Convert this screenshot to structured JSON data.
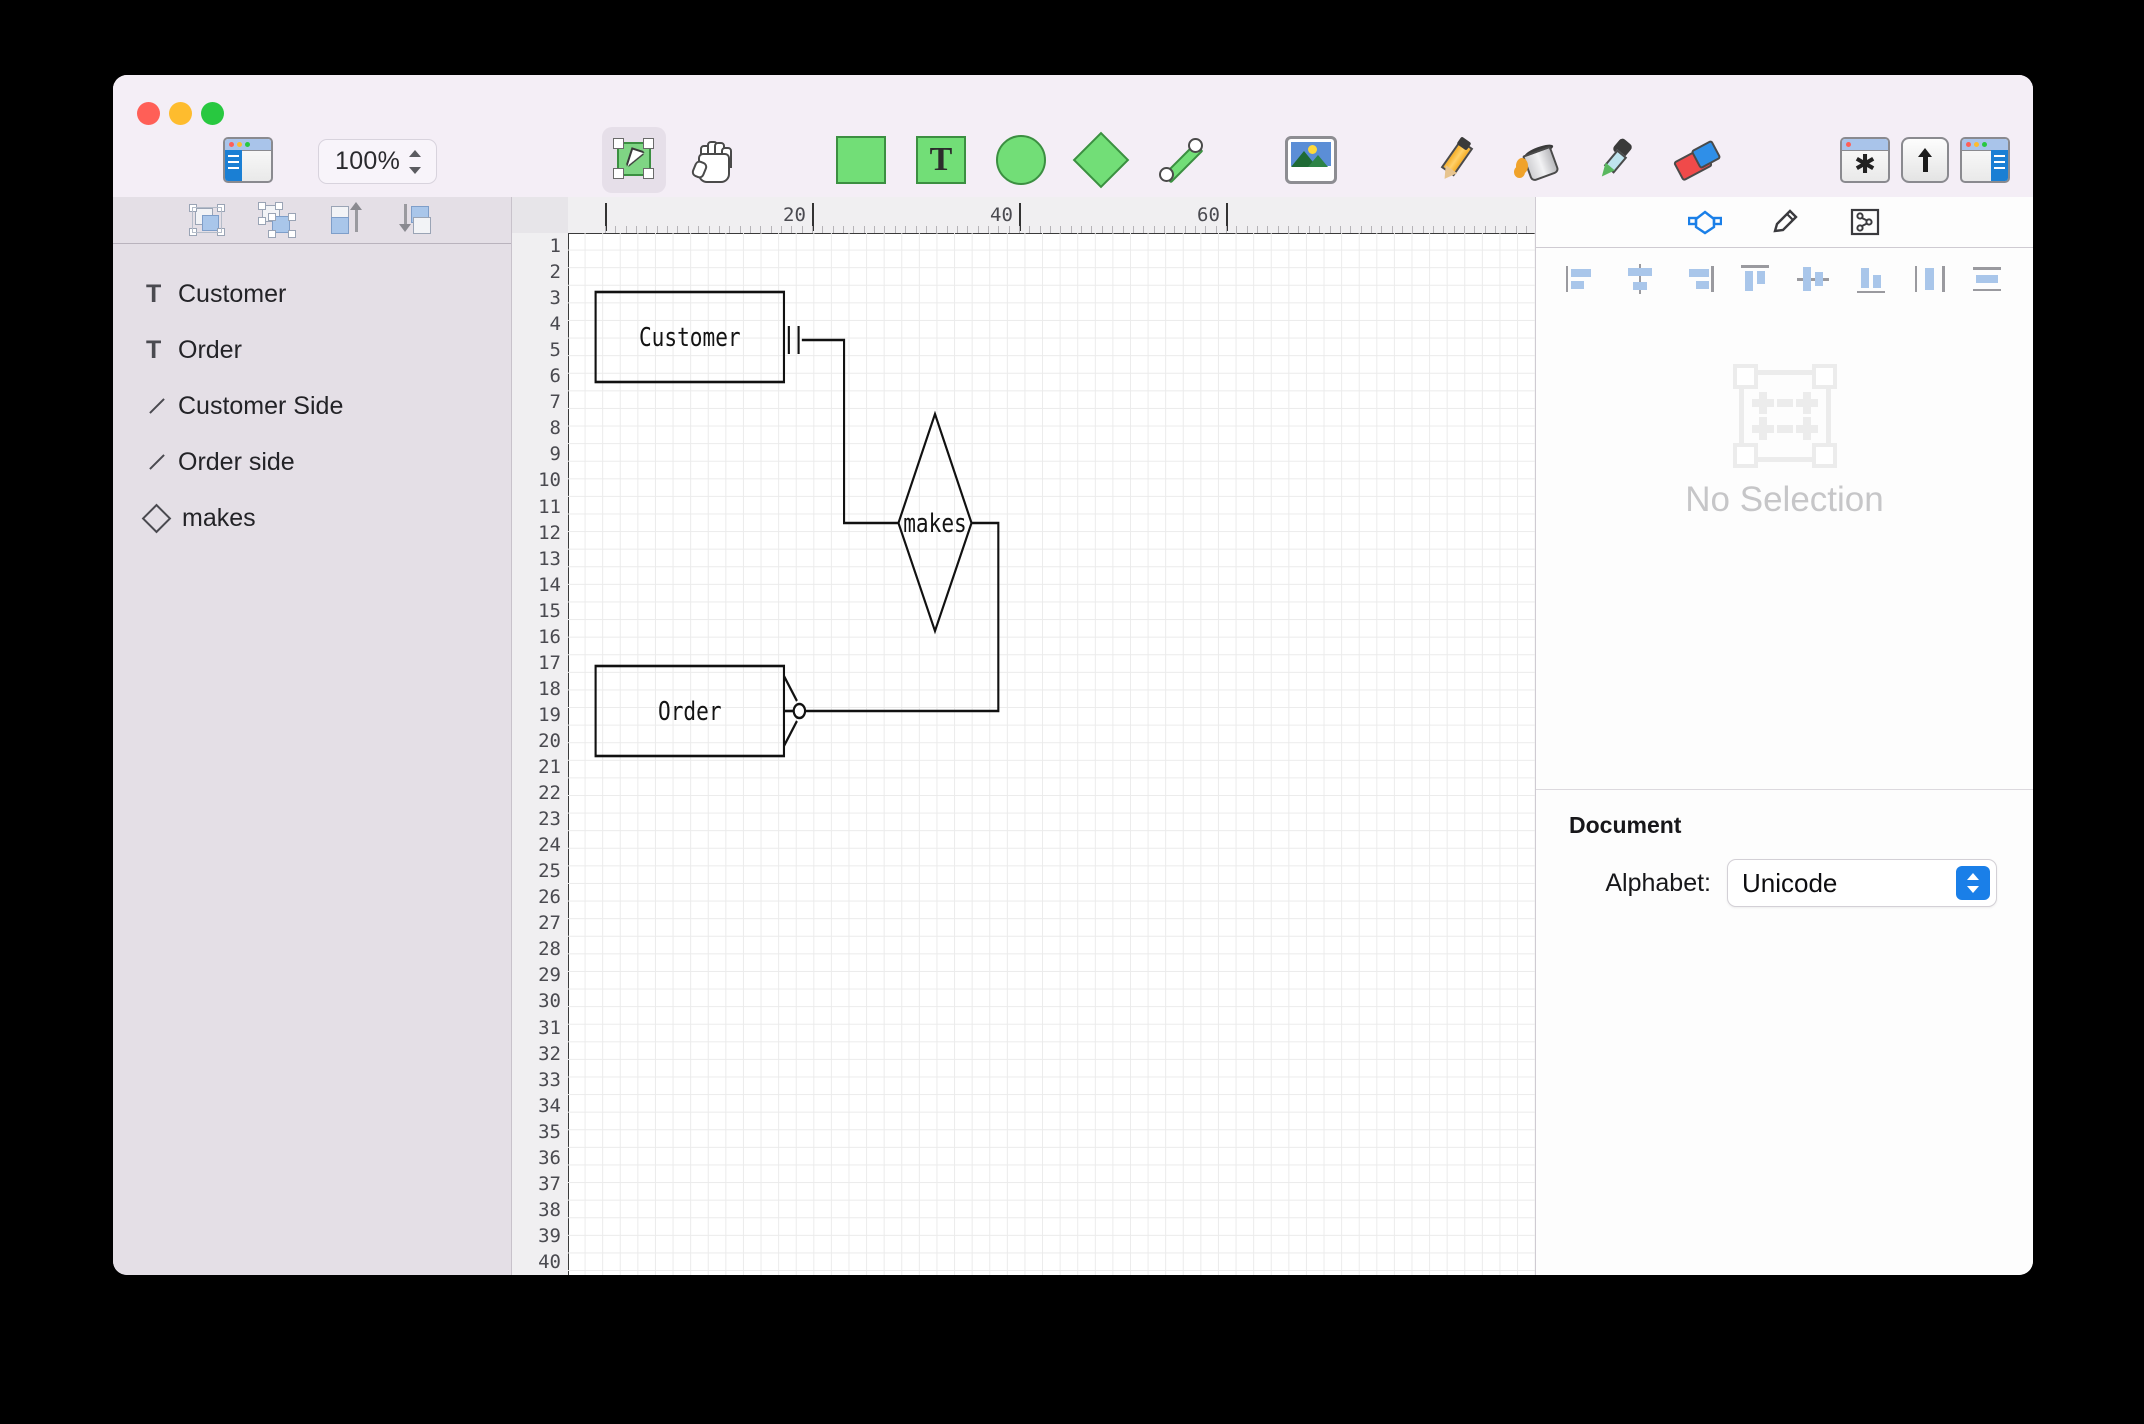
{
  "window": {
    "traffic_lights": [
      "close",
      "minimize",
      "zoom"
    ],
    "colors": {
      "close": "#ff5f57",
      "minimize": "#febc2e",
      "zoom": "#28c840",
      "accent": "#1a7fe8",
      "shape_fill": "#72de77",
      "shape_stroke": "#3b8f41"
    }
  },
  "toolbar": {
    "left_sidebar_toggle": "sidebar-left-icon",
    "zoom": {
      "value": "100%",
      "stepper": "stepper-icon"
    },
    "tools": [
      {
        "name": "select-tool",
        "icon": "select-arrow-icon",
        "active": true
      },
      {
        "name": "hand-tool",
        "icon": "hand-icon",
        "active": false
      },
      {
        "name": "rectangle-tool",
        "icon": "square-icon",
        "active": false
      },
      {
        "name": "text-tool",
        "icon": "text-T-icon",
        "label": "T",
        "active": false
      },
      {
        "name": "ellipse-tool",
        "icon": "circle-icon",
        "active": false
      },
      {
        "name": "diamond-tool",
        "icon": "diamond-icon",
        "active": false
      },
      {
        "name": "line-tool",
        "icon": "line-icon",
        "active": false
      },
      {
        "name": "image-tool",
        "icon": "picture-icon",
        "active": false
      },
      {
        "name": "pencil-tool",
        "icon": "pencil-icon",
        "active": false
      },
      {
        "name": "fill-tool",
        "icon": "paint-bucket-icon",
        "active": false
      },
      {
        "name": "eyedropper-tool",
        "icon": "eyedropper-icon",
        "active": false
      },
      {
        "name": "eraser-tool",
        "icon": "eraser-icon",
        "active": false
      }
    ],
    "right_buttons": [
      {
        "name": "notes-button",
        "icon": "window-asterisk-icon",
        "glyph": "✱"
      },
      {
        "name": "share-button",
        "icon": "up-arrow-icon"
      },
      {
        "name": "right-sidebar-toggle",
        "icon": "sidebar-right-icon"
      }
    ]
  },
  "sidebar": {
    "arrange_tools": [
      {
        "name": "group-button",
        "icon": "group-icon"
      },
      {
        "name": "ungroup-button",
        "icon": "ungroup-icon"
      },
      {
        "name": "bring-forward-button",
        "icon": "bring-forward-icon"
      },
      {
        "name": "send-backward-button",
        "icon": "send-backward-icon"
      }
    ],
    "items": [
      {
        "label": "Customer",
        "icon": "text-object-icon",
        "glyph": "T"
      },
      {
        "label": "Order",
        "icon": "text-object-icon",
        "glyph": "T"
      },
      {
        "label": "Customer Side",
        "icon": "line-object-icon",
        "glyph": ""
      },
      {
        "label": "Order side",
        "icon": "line-object-icon",
        "glyph": ""
      },
      {
        "label": "makes",
        "icon": "diamond-object-icon",
        "glyph": ""
      }
    ]
  },
  "canvas": {
    "h_ruler_labels": [
      "20",
      "40",
      "60"
    ],
    "v_ruler_labels": [
      "1",
      "2",
      "3",
      "4",
      "5",
      "6",
      "7",
      "8",
      "9",
      "10",
      "11",
      "12",
      "13",
      "14",
      "15",
      "16",
      "17",
      "18",
      "19",
      "20",
      "21",
      "22",
      "23",
      "24",
      "25",
      "26",
      "27",
      "28",
      "29",
      "30",
      "31",
      "32",
      "33",
      "34",
      "35",
      "36",
      "37",
      "38",
      "39",
      "40"
    ],
    "shapes": {
      "customer_entity": "Customer",
      "order_entity": "Order",
      "relationship_diamond": "makes"
    },
    "notation": {
      "customer_side": "one-and-only-one",
      "order_side": "zero-or-many"
    }
  },
  "inspector": {
    "tabs": [
      {
        "name": "shape-inspector-tab",
        "icon": "shape-node-icon",
        "active": true
      },
      {
        "name": "style-inspector-tab",
        "icon": "pencil-icon",
        "active": false
      },
      {
        "name": "connections-inspector-tab",
        "icon": "graph-node-icon",
        "active": false
      }
    ],
    "align_tools": [
      {
        "name": "align-left-button",
        "icon": "align-left-icon"
      },
      {
        "name": "align-center-horizontal-button",
        "icon": "align-center-h-icon"
      },
      {
        "name": "align-right-button",
        "icon": "align-right-icon"
      },
      {
        "name": "align-top-button",
        "icon": "align-top-icon"
      },
      {
        "name": "align-center-vertical-button",
        "icon": "align-center-v-icon"
      },
      {
        "name": "align-bottom-button",
        "icon": "align-bottom-icon"
      },
      {
        "name": "distribute-horizontally-button",
        "icon": "distribute-h-icon"
      },
      {
        "name": "distribute-vertically-button",
        "icon": "distribute-v-icon"
      }
    ],
    "no_selection_text": "No Selection",
    "document": {
      "title": "Document",
      "alphabet_label": "Alphabet:",
      "alphabet_value": "Unicode",
      "alphabet_options": [
        "Unicode"
      ]
    }
  }
}
